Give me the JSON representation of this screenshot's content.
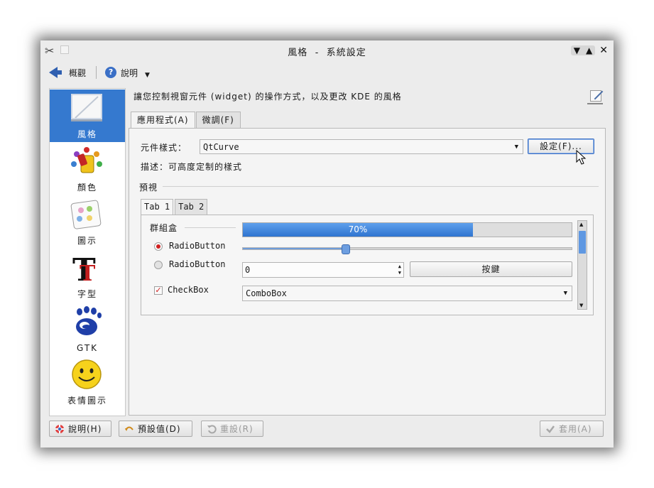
{
  "window": {
    "title": "風格 - 系統設定"
  },
  "toolbar": {
    "overview_label": "概觀",
    "help_label": "說明"
  },
  "sidebar": {
    "items": [
      {
        "label": "風格",
        "icon": "style-icon",
        "active": true
      },
      {
        "label": "顏色",
        "icon": "colors-icon",
        "active": false
      },
      {
        "label": "圖示",
        "icon": "icons-icon",
        "active": false
      },
      {
        "label": "字型",
        "icon": "fonts-icon",
        "active": false
      },
      {
        "label": "GTK",
        "icon": "gtk-icon",
        "active": false
      },
      {
        "label": "表情圖示",
        "icon": "emoticons-icon",
        "active": false
      }
    ]
  },
  "header": {
    "description": "讓您控制視窗元件 (widget) 的操作方式，以及更改 KDE 的風格"
  },
  "main_tabs": [
    {
      "label": "應用程式(A)",
      "active": true
    },
    {
      "label": "微調(F)",
      "active": false
    }
  ],
  "style": {
    "widget_style_label": "元件樣式：",
    "widget_style_value": "QtCurve",
    "configure_button": "設定(F)...",
    "description": "描述：可高度定制的樣式"
  },
  "preview": {
    "section_label": "預視",
    "tabs": [
      {
        "label": "Tab 1",
        "active": true
      },
      {
        "label": "Tab 2",
        "active": false
      }
    ],
    "groupbox_label": "群組盒",
    "progress_percent": 70,
    "progress_text": "70%",
    "radio1_label": "RadioButton",
    "radio1_checked": true,
    "radio2_label": "RadioButton",
    "radio2_checked": false,
    "slider_fraction": 0.31,
    "spin_value": "0",
    "push_button_label": "按鍵",
    "checkbox_label": "CheckBox",
    "checkbox_checked": true,
    "combobox_value": "ComboBox"
  },
  "bottom": {
    "help_label": "說明(H)",
    "defaults_label": "預設值(D)",
    "reset_label": "重設(R)",
    "apply_label": "套用(A)"
  },
  "colors": {
    "accent": "#3579cf",
    "selection": "#3579cf",
    "check_mark": "#d02020"
  }
}
